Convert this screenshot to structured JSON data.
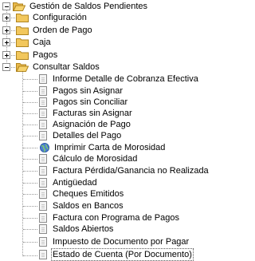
{
  "tree": {
    "root_label": "Gestión de Saldos Pendientes",
    "folders": [
      {
        "label": "Configuración",
        "expanded": false
      },
      {
        "label": "Orden de Pago",
        "expanded": false
      },
      {
        "label": "Caja",
        "expanded": false
      },
      {
        "label": "Pagos",
        "expanded": false
      },
      {
        "label": "Consultar Saldos",
        "expanded": true
      }
    ],
    "items": [
      {
        "label": "Informe Detalle de Cobranza Efectiva",
        "icon": "document-icon"
      },
      {
        "label": "Pagos sin Asignar",
        "icon": "document-icon"
      },
      {
        "label": "Pagos sin Conciliar",
        "icon": "document-icon"
      },
      {
        "label": "Facturas sin Asignar",
        "icon": "document-icon"
      },
      {
        "label": "Asignación de Pago",
        "icon": "document-icon"
      },
      {
        "label": "Detalles del Pago",
        "icon": "document-icon"
      },
      {
        "label": "Imprimir Carta de Morosidad",
        "icon": "globe-icon"
      },
      {
        "label": "Cálculo de Morosidad",
        "icon": "document-icon"
      },
      {
        "label": "Factura Pérdida/Ganancia no Realizada",
        "icon": "document-icon"
      },
      {
        "label": "Antigüedad",
        "icon": "document-icon"
      },
      {
        "label": "Cheques Emitidos",
        "icon": "document-icon"
      },
      {
        "label": "Saldos en Bancos",
        "icon": "document-icon"
      },
      {
        "label": "Factura con Programa de Pagos",
        "icon": "document-icon"
      },
      {
        "label": "Saldos Abiertos",
        "icon": "document-icon"
      },
      {
        "label": "Impuesto de Documento por Pagar",
        "icon": "document-icon"
      },
      {
        "label": "Estado de Cuenta (Por Documento)",
        "icon": "document-icon",
        "selected": true
      }
    ]
  }
}
